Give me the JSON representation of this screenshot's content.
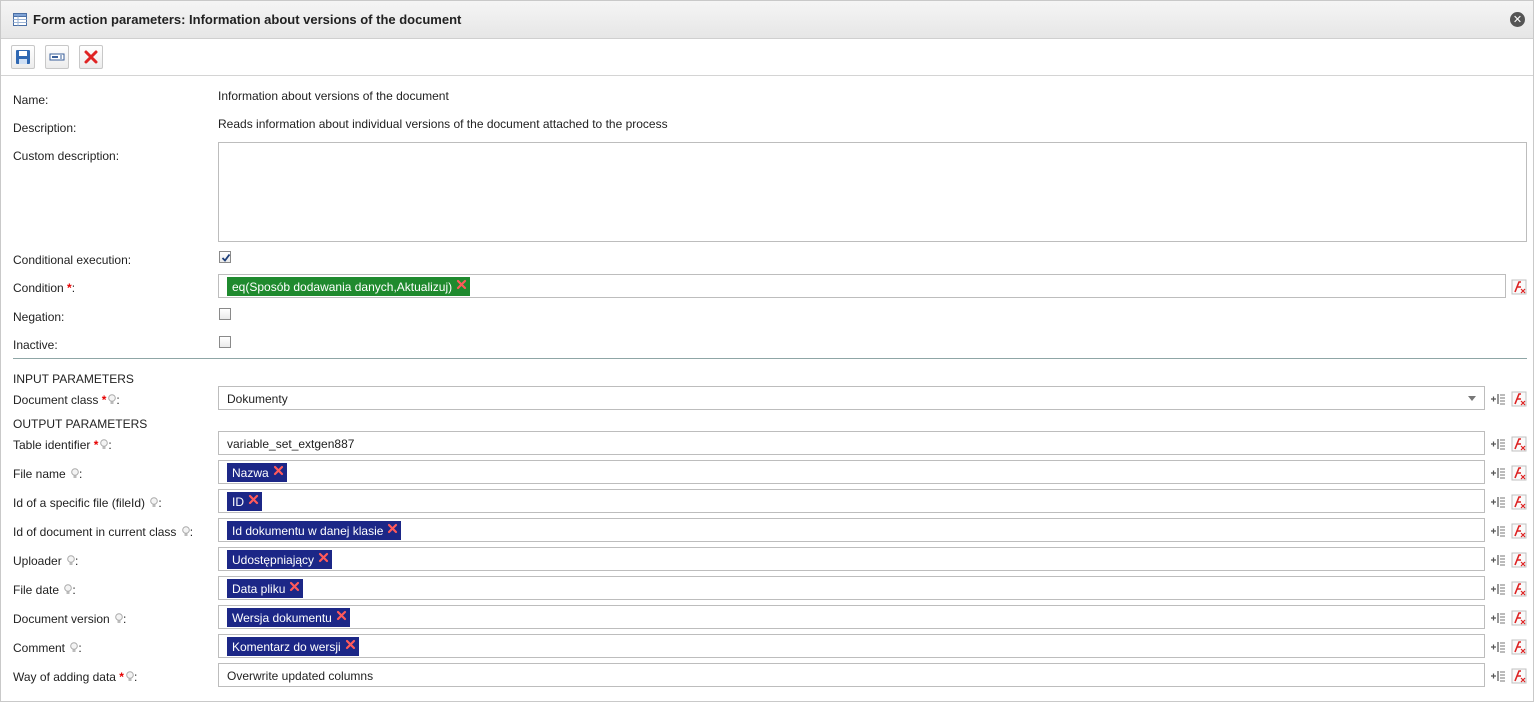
{
  "window": {
    "title": "Form action parameters: Information about versions of the document",
    "close_glyph": "✕"
  },
  "toolbar": {
    "buttons": [
      {
        "name": "save-icon"
      },
      {
        "name": "field-icon"
      },
      {
        "name": "delete-icon"
      }
    ]
  },
  "general": {
    "name_label": "Name:",
    "name_value": "Information about versions of the document",
    "description_label": "Description:",
    "description_value": "Reads information about individual versions of the document attached to the process",
    "custom_description_label": "Custom description:",
    "custom_description_value": "",
    "conditional_label": "Conditional execution:",
    "conditional_checked": true,
    "condition_label": "Condition ",
    "condition_tag": "eq(Sposób dodawania danych,Aktualizuj)",
    "negation_label": "Negation:",
    "negation_checked": false,
    "inactive_label": "Inactive:",
    "inactive_checked": false
  },
  "input_params": {
    "heading": "INPUT PARAMETERS",
    "document_class_label": "Document class ",
    "document_class_value": "Dokumenty"
  },
  "output_params": {
    "heading": "OUTPUT PARAMETERS",
    "table_identifier_label": "Table identifier ",
    "table_identifier_value": "variable_set_extgen887",
    "rows": [
      {
        "label": "File name ",
        "tag": "Nazwa"
      },
      {
        "label": "Id of a specific file (fileId) ",
        "tag": "ID"
      },
      {
        "label": "Id of document in current class ",
        "tag": "Id dokumentu w danej klasie"
      },
      {
        "label": "Uploader ",
        "tag": "Udostępniający"
      },
      {
        "label": "File date ",
        "tag": "Data pliku"
      },
      {
        "label": "Document version ",
        "tag": "Wersja dokumentu"
      },
      {
        "label": "Comment ",
        "tag": "Komentarz do wersji"
      }
    ],
    "way_label": "Way of adding data ",
    "way_value": "Overwrite updated columns"
  },
  "common": {
    "required_mark": "*",
    "colon": ":"
  },
  "colors": {
    "tag_blue": "#1c2787",
    "tag_green": "#1f8a2e",
    "required": "#e60000"
  }
}
